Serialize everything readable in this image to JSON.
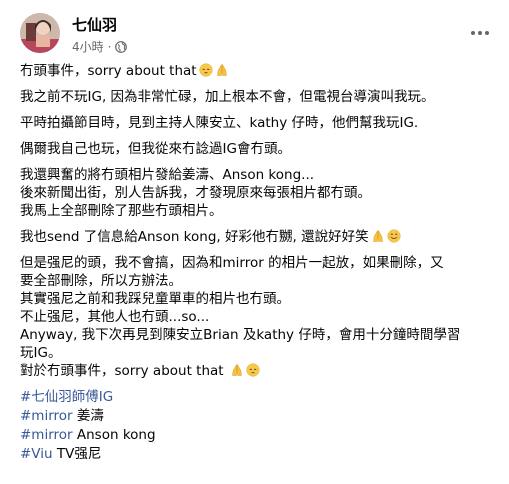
{
  "post": {
    "author": "七仙羽",
    "time": "4小時",
    "separator": "·",
    "paragraphs": [
      {
        "lines": [
          {
            "text": "冇頭事件，sorry about that",
            "emojis": [
              "pensive",
              "folded-hands"
            ]
          }
        ]
      },
      {
        "lines": [
          {
            "text": "我之前不玩IG, 因為非常忙碌，加上根本不會，但電視台導演叫我玩。"
          }
        ]
      },
      {
        "lines": [
          {
            "text": "平時拍攝節目時，見到主持人陳安立、kathy 仔時，他們幫我玩IG."
          }
        ]
      },
      {
        "lines": [
          {
            "text": "偶爾我自己也玩，但我從來冇諗過IG會冇頭。"
          }
        ]
      },
      {
        "lines": [
          {
            "text": "我還興奮的將冇頭相片發給姜濤、Anson kong..."
          },
          {
            "text": "後來新聞出街，別人告訴我，才發現原來每張相片都冇頭。"
          },
          {
            "text": "我馬上全部刪除了那些冇頭相片。"
          }
        ]
      },
      {
        "lines": [
          {
            "text": "我也send 了信息給Anson kong, 好彩他冇嬲, 還說好好笑",
            "emojis": [
              "folded-hands",
              "smiling"
            ]
          }
        ]
      },
      {
        "lines": [
          {
            "text": "但是强尼的頭，我不會搞，因為和mirror 的相片一起放，如果刪除，又"
          },
          {
            "text": "要全部刪除，所以方辦法。"
          },
          {
            "text": "其實强尼之前和我踩兒童單車的相片也冇頭。"
          },
          {
            "text": "不止强尼，其他人也冇頭...so..."
          },
          {
            "text": "Anyway, 我下次再見到陳安立Brian 及kathy 仔時，會用十分鐘時間學習"
          },
          {
            "text": "玩IG。"
          },
          {
            "text": "對於冇頭事件，sorry about that ",
            "emojis": [
              "folded-hands",
              "pensive"
            ]
          }
        ]
      }
    ],
    "tags": [
      {
        "hashtag": "#七仙羽師傅IG",
        "rest": ""
      },
      {
        "hashtag": "#mirror",
        "rest": " 姜濤"
      },
      {
        "hashtag": "#mirror",
        "rest": " Anson kong"
      },
      {
        "hashtag": "#Viu",
        "rest": " TV强尼"
      }
    ]
  },
  "colors": {
    "link": "#385898",
    "meta": "#65676b",
    "text": "#050505"
  }
}
